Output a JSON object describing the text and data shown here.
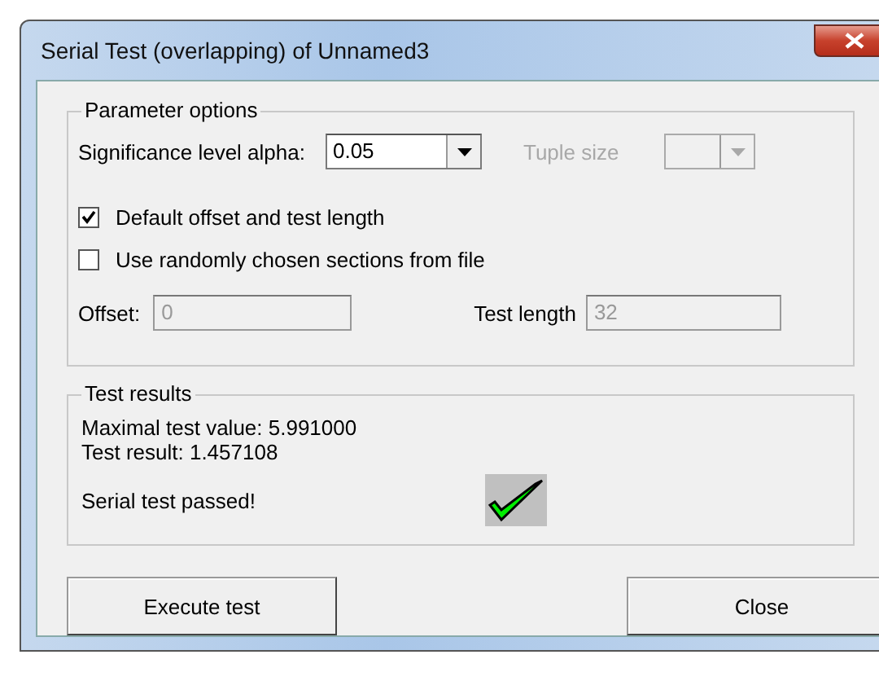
{
  "window": {
    "title": "Serial Test (overlapping) of Unnamed3"
  },
  "parameter_options": {
    "label": "Parameter options",
    "alpha": {
      "label": "Significance level alpha:",
      "value": "0.05",
      "disabled": false
    },
    "tuple_size": {
      "label": "Tuple size",
      "disabled": true
    },
    "checkboxes": [
      {
        "label": "Default offset and test length",
        "checked": true
      },
      {
        "label": "Use randomly chosen sections from file",
        "checked": false
      }
    ],
    "offset": {
      "label": "Offset:",
      "value": "0",
      "disabled": true
    },
    "test_length": {
      "label": "Test length",
      "value": "32",
      "disabled": true
    }
  },
  "test_results": {
    "label": "Test results",
    "lines": [
      "Maximal test value: 5.991000",
      "Test result: 1.457108"
    ],
    "verdict": "Serial test passed!",
    "passed": true
  },
  "buttons": [
    "Execute test",
    "Close"
  ]
}
